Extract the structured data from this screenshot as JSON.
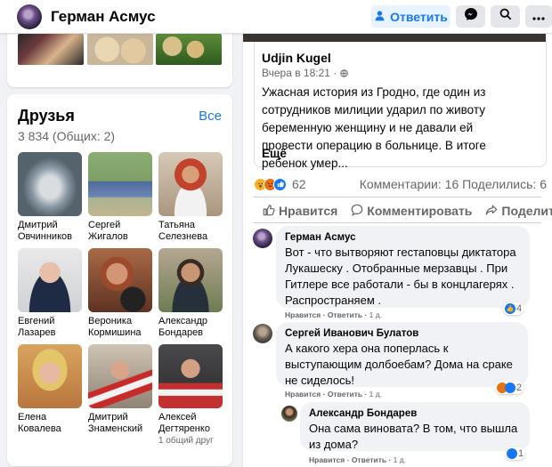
{
  "header": {
    "profile_name": "Герман Асмус",
    "reply_label": "Ответить",
    "icons": [
      "user-icon",
      "messenger-icon",
      "search-icon",
      "more-icon"
    ]
  },
  "friends": {
    "title": "Друзья",
    "all_label": "Все",
    "count": "3 834 (Общих: 2)",
    "items": [
      {
        "name": "Дмитрий Овчинников",
        "mutual": ""
      },
      {
        "name": "Сергей Жигалов",
        "mutual": ""
      },
      {
        "name": "Татьяна Селезнева",
        "mutual": ""
      },
      {
        "name": "Евгений Лазарев",
        "mutual": ""
      },
      {
        "name": "Вероника Кормишина",
        "mutual": ""
      },
      {
        "name": "Александр Бондарев",
        "mutual": ""
      },
      {
        "name": "Елена Ковалева",
        "mutual": ""
      },
      {
        "name": "Дмитрий Знаменский",
        "mutual": ""
      },
      {
        "name": "Алексей Дегтяренко",
        "mutual": "1 общий друг"
      }
    ]
  },
  "post": {
    "shared": {
      "author": "Udjin Kugel",
      "time": "Вчера в 18:21 ·",
      "text": "Ужасная история из Гродно, где один из сотрудников милиции ударил по животу беременную женщину и не давали ей провести операцию в больнице. В итоге ребенок умер...",
      "more": "Ещё"
    },
    "reactions_count": "62",
    "stats": "Комментарии: 16 Поделились: 6",
    "actions": {
      "like": "Нравится",
      "comment": "Комментировать",
      "share": "Поделиться"
    }
  },
  "comments": [
    {
      "author": "Герман Асмус",
      "text": "Вот - что вытворяют гестаповцы диктатора Лукашеску . Отобранные мерзавцы . При Гитлере все работали - бы в концлагерях . Распространяем .",
      "like": "Нравится",
      "reply": "Ответить",
      "time": "1 д.",
      "reactions": "4"
    },
    {
      "author": "Сергей Иванович Булатов",
      "text": "А какого хера она поперлась к выступающим долбоебам? Дома на сраке не сиделось!",
      "like": "Нравится",
      "reply": "Ответить",
      "time": "1 д.",
      "reactions": "2"
    },
    {
      "author": "Александр Бондарев",
      "text": "Она сама виновата? В том, что вышла из дома?",
      "like": "Нравится",
      "reply": "Ответить",
      "time": "1 д.",
      "reactions": "1"
    }
  ],
  "colors": {
    "accent": "#1877f2",
    "background": "#f0f2f5",
    "muted": "#65676b"
  }
}
